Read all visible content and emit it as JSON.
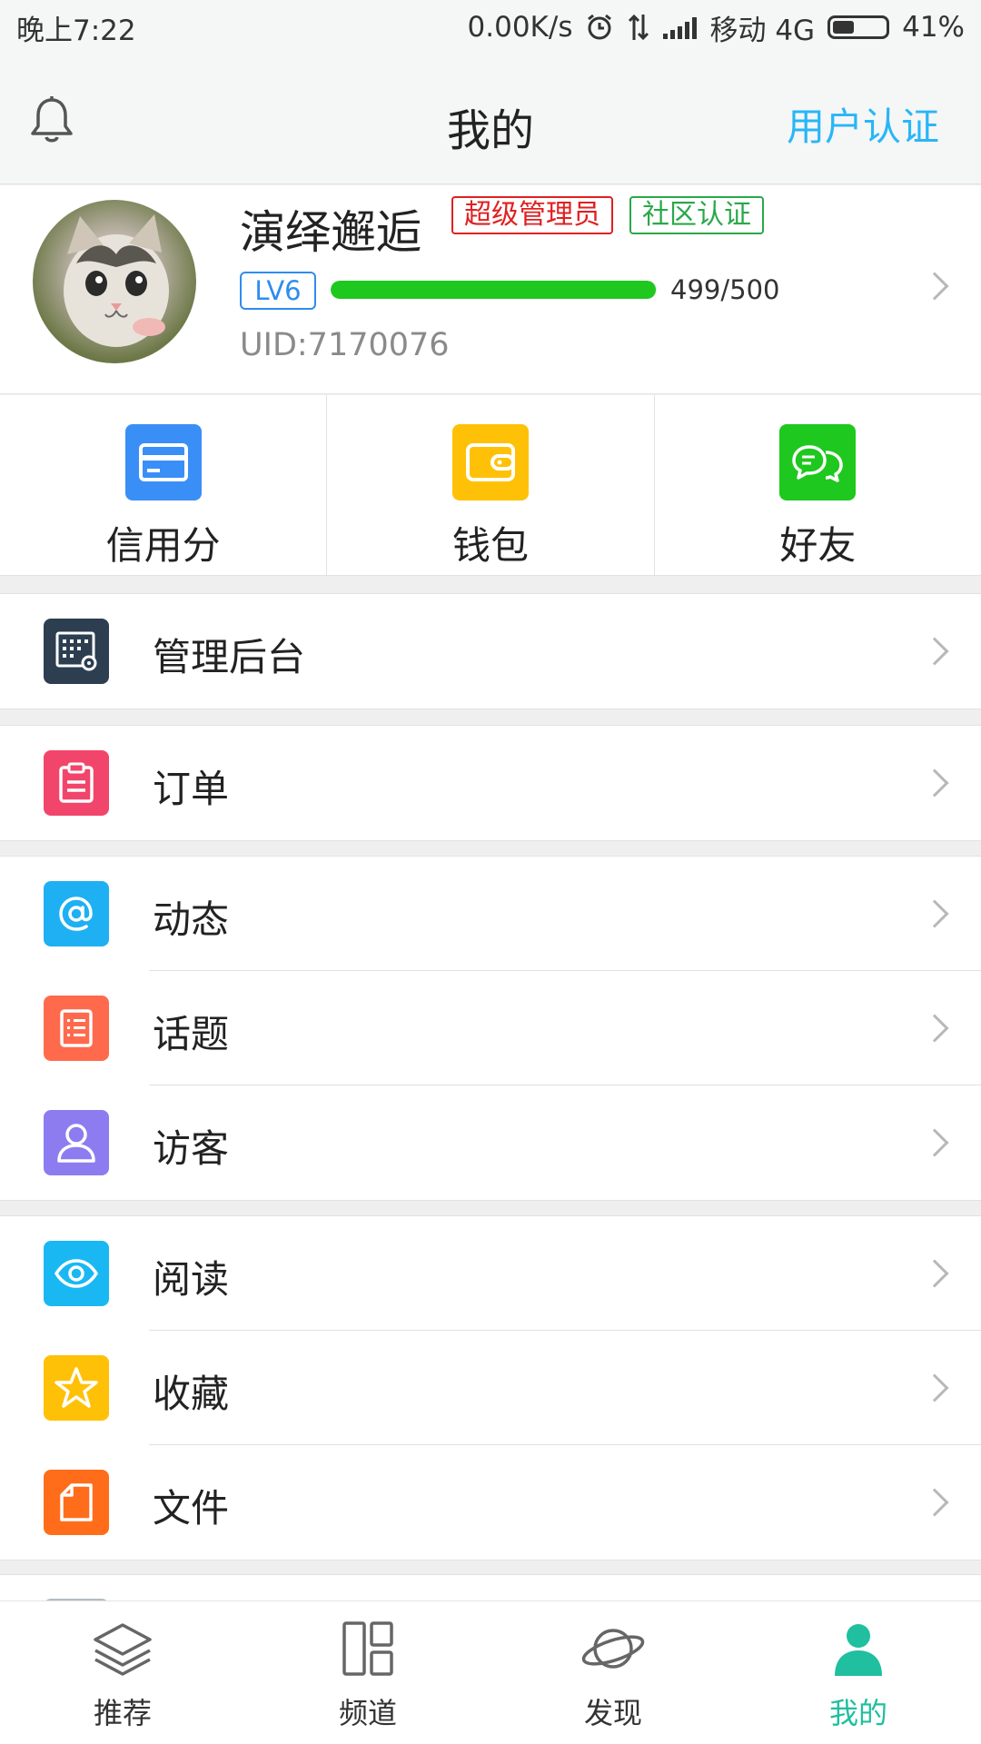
{
  "status_bar": {
    "time": "晚上7:22",
    "speed": "0.00K/s",
    "carrier": "移动 4G",
    "battery": "41%",
    "battery_level": 0.41
  },
  "header": {
    "title": "我的",
    "verify_label": "用户认证",
    "accent_color": "#29b6f6"
  },
  "profile": {
    "username": "演绎邂逅",
    "tags": [
      "超级管理员",
      "社区认证"
    ],
    "level": "LV6",
    "exp_text": "499/500",
    "exp_fraction": 0.998,
    "uid": "UID:7170076"
  },
  "quick_actions": [
    {
      "label": "信用分",
      "icon": "credit-card-icon",
      "color": "#3a8ff7"
    },
    {
      "label": "钱包",
      "icon": "wallet-icon",
      "color": "#ffc107"
    },
    {
      "label": "好友",
      "icon": "chat-bubbles-icon",
      "color": "#1ec81e"
    }
  ],
  "menu": {
    "admin": {
      "label": "管理后台",
      "icon": "admin-panel-icon",
      "color": "#2c3e50"
    },
    "orders": {
      "label": "订单",
      "icon": "clipboard-icon",
      "color": "#f2456b"
    },
    "activity": {
      "label": "动态",
      "icon": "at-icon",
      "color": "#1fb0f3"
    },
    "topics": {
      "label": "话题",
      "icon": "list-icon",
      "color": "#ff6a4d"
    },
    "visitors": {
      "label": "访客",
      "icon": "person-icon",
      "color": "#8c7cf0"
    },
    "reading": {
      "label": "阅读",
      "icon": "eye-icon",
      "color": "#1ab8f3"
    },
    "favorites": {
      "label": "收藏",
      "icon": "star-icon",
      "color": "#ffc107"
    },
    "files": {
      "label": "文件",
      "icon": "file-icon",
      "color": "#ff6d1a"
    }
  },
  "tabs": [
    {
      "label": "推荐",
      "icon": "layers-icon"
    },
    {
      "label": "频道",
      "icon": "grid-icon"
    },
    {
      "label": "发现",
      "icon": "planet-icon"
    },
    {
      "label": "我的",
      "icon": "user-icon",
      "active": true
    }
  ]
}
